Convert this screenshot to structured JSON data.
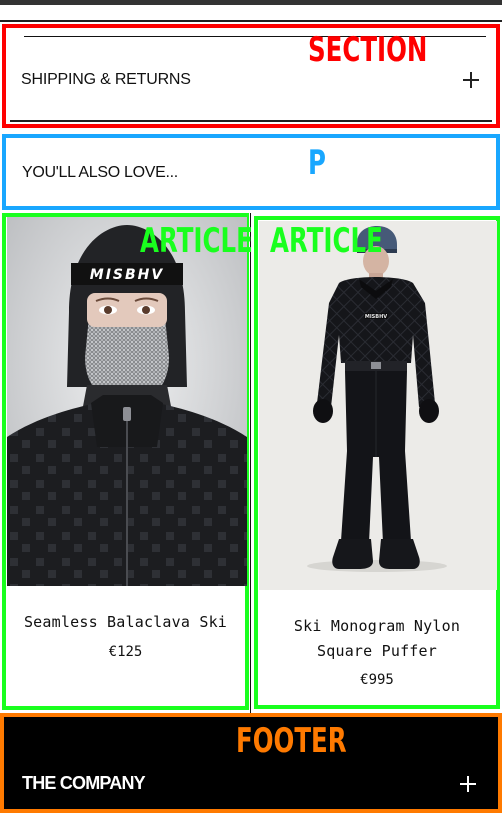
{
  "shipping_section": {
    "title": "SHIPPING & RETURNS",
    "expand_icon": "plus-icon",
    "annotation": "SECTION",
    "annotation_color": "#ff0000"
  },
  "recommendations": {
    "heading": "YOU'LL ALSO LOVE...",
    "annotation": "P",
    "annotation_color": "#19a7ff"
  },
  "products": [
    {
      "name": "Seamless Balaclava Ski",
      "price": "€125",
      "image_text": "MISBHV",
      "annotation": "ARTICLE"
    },
    {
      "name": "Ski Monogram Nylon Square Puffer",
      "price": "€995",
      "image_text": "MISBHV",
      "annotation": "ARTICLE"
    }
  ],
  "article_annotation_color": "#19ff1e",
  "footer": {
    "title": "THE COMPANY",
    "expand_icon": "plus-icon",
    "annotation": "FOOTER",
    "annotation_color": "#ff7a00",
    "background": "#000000"
  }
}
